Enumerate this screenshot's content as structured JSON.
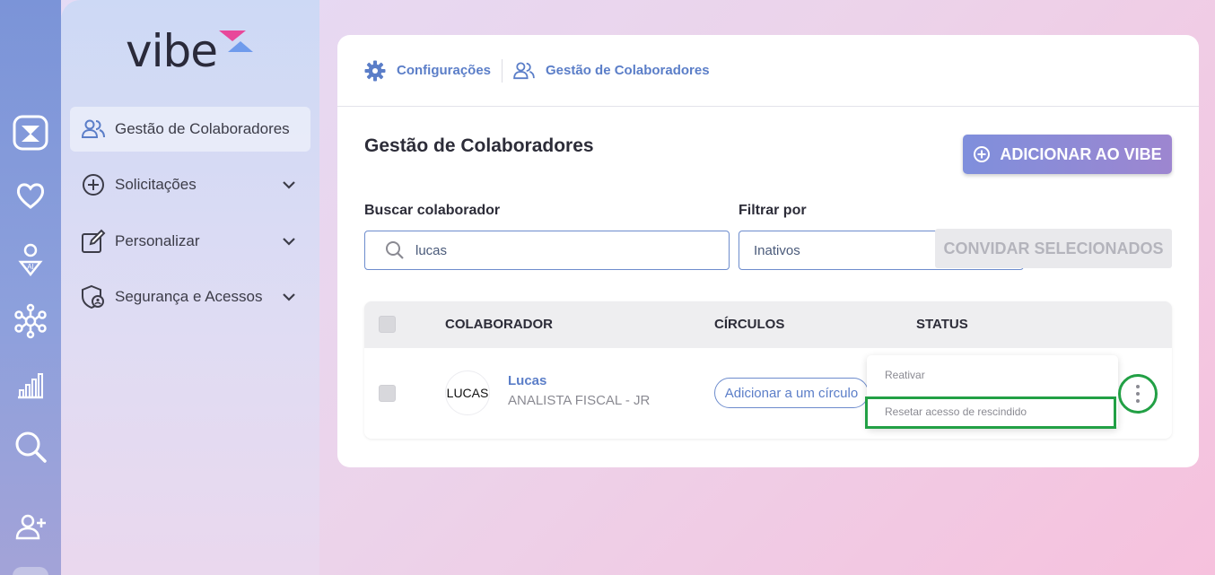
{
  "rail": {
    "icons": [
      "vibe-app-icon",
      "heart-icon",
      "ai-person-icon",
      "network-icon",
      "bar-chart-icon",
      "search-icon",
      "add-user-icon"
    ]
  },
  "sidebar": {
    "logo": "vibe",
    "items": [
      {
        "label": "Gestão de Colaboradores",
        "icon": "users-icon",
        "active": true
      },
      {
        "label": "Solicitações",
        "icon": "plus-circle-icon",
        "expandable": true
      },
      {
        "label": "Personalizar",
        "icon": "edit-icon",
        "expandable": true
      },
      {
        "label": "Segurança e Acessos",
        "icon": "shield-user-icon",
        "expandable": true
      }
    ]
  },
  "breadcrumb": {
    "items": [
      {
        "label": "Configurações",
        "icon": "gear-icon"
      },
      {
        "label": "Gestão de Colaboradores",
        "icon": "users-icon"
      }
    ]
  },
  "main": {
    "title": "Gestão de Colaboradores",
    "add_button": "ADICIONAR AO VIBE",
    "search_label": "Buscar colaborador",
    "search_value": "lucas",
    "filter_label": "Filtrar por",
    "filter_value": "Inativos",
    "invite_button": "CONVIDAR SELECIONADOS"
  },
  "table": {
    "headers": [
      "COLABORADOR",
      "CÍRCULOS",
      "STATUS"
    ],
    "rows": [
      {
        "avatar_text": "LUCAS",
        "name": "Lucas",
        "role": "ANALISTA FISCAL - JR",
        "circle_button": "Adicionar a um círculo"
      }
    ]
  },
  "dropdown": {
    "items": [
      "Reativar",
      "Resetar acesso de rescindido"
    ]
  },
  "colors": {
    "accent": "#5b7ec8",
    "highlight": "#22a045",
    "button_gradient_start": "#7f8fdc",
    "button_gradient_end": "#9d86d0"
  }
}
